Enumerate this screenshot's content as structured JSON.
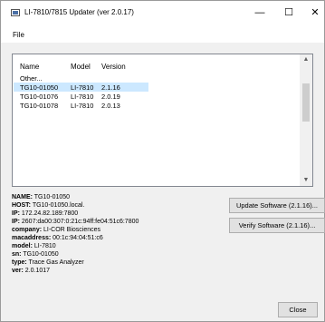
{
  "window": {
    "title": "LI-7810/7815 Updater (ver 2.0.17)",
    "minimize_glyph": "—",
    "maximize_glyph": "☐",
    "close_glyph": "✕"
  },
  "menubar": {
    "items": [
      {
        "label": "File"
      }
    ]
  },
  "devices": {
    "columns": [
      "Name",
      "Model",
      "Version"
    ],
    "rows": [
      {
        "name": "Other...",
        "model": "",
        "version": "",
        "selected": false
      },
      {
        "name": "TG10-01050",
        "model": "LI-7810",
        "version": "2.1.16",
        "selected": true
      },
      {
        "name": "TG10-01076",
        "model": "LI-7810",
        "version": "2.0.19",
        "selected": false
      },
      {
        "name": "TG10-01078",
        "model": "LI-7810",
        "version": "2.0.13",
        "selected": false
      }
    ]
  },
  "details": [
    {
      "key": "NAME:",
      "value": " TG10-01050"
    },
    {
      "key": "HOST:",
      "value": " TG10-01050.local."
    },
    {
      "key": "IP:",
      "value": " 172.24.82.189:7800"
    },
    {
      "key": "IP:",
      "value": " 2607:da00:307:0:21c:94ff:fe04:51c6:7800"
    },
    {
      "key": "company:",
      "value": " LI-COR Biosciences"
    },
    {
      "key": "macaddress:",
      "value": " 00:1c:94:04:51:c6"
    },
    {
      "key": "model:",
      "value": " LI-7810"
    },
    {
      "key": "sn:",
      "value": " TG10-01050"
    },
    {
      "key": "type:",
      "value": " Trace Gas Analyzer"
    },
    {
      "key": "ver:",
      "value": " 2.0.1017"
    }
  ],
  "buttons": {
    "update": "Update Software (2.1.16)...",
    "verify": "Verify Software (2.1.16)...",
    "close": "Close"
  },
  "colors": {
    "selection": "#cce8ff",
    "window_bg": "#f0f0f0",
    "button_bg": "#e1e1e1"
  }
}
